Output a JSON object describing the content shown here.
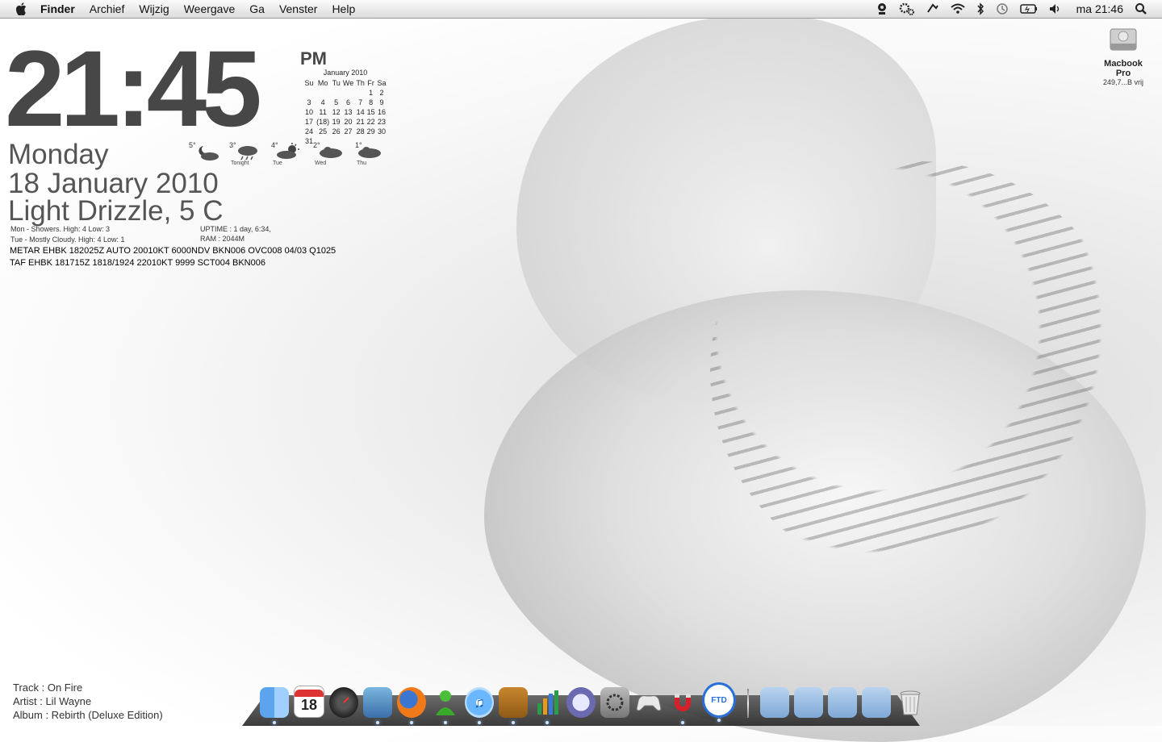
{
  "menubar": {
    "app_name": "Finder",
    "menus": [
      "Archief",
      "Wijzig",
      "Weergave",
      "Ga",
      "Venster",
      "Help"
    ],
    "clock": "ma 21:46"
  },
  "widget": {
    "time": "21:45",
    "ampm": "PM",
    "day": "Monday",
    "date": "18 January 2010",
    "condition": "Light Drizzle, 5 C",
    "forecast_line1": "Mon - Showers. High: 4 Low: 3",
    "forecast_line2": "Tue - Mostly Cloudy. High: 4 Low: 1",
    "uptime": "UPTIME : 1 day, 6:34,",
    "ram": "RAM : 2044M",
    "metar": "METAR EHBK 182025Z AUTO 20010KT 6000NDV BKN006 OVC008 04/03 Q1025",
    "taf": "TAF EHBK 181715Z 1818/1924 22010KT 9999 SCT004 BKN006"
  },
  "calendar": {
    "title": "January 2010",
    "days": [
      "Su",
      "Mo",
      "Tu",
      "We",
      "Th",
      "Fr",
      "Sa"
    ],
    "weeks": [
      [
        "",
        "",
        "",
        "",
        "",
        "1",
        "2"
      ],
      [
        "3",
        "4",
        "5",
        "6",
        "7",
        "8",
        "9"
      ],
      [
        "10",
        "11",
        "12",
        "13",
        "14",
        "15",
        "16"
      ],
      [
        "17",
        "(18)",
        "19",
        "20",
        "21",
        "22",
        "23"
      ],
      [
        "24",
        "25",
        "26",
        "27",
        "28",
        "29",
        "30"
      ],
      [
        "31",
        "",
        "",
        "",
        "",
        "",
        ""
      ]
    ]
  },
  "forecast": [
    {
      "temp": "5°",
      "label": "",
      "icon": "night-cloud-icon"
    },
    {
      "temp": "3°",
      "label": "Tonight",
      "icon": "rain-cloud-icon"
    },
    {
      "temp": "4°",
      "label": "Tue",
      "icon": "sun-cloud-icon"
    },
    {
      "temp": "2°",
      "label": "Wed",
      "icon": "cloud-icon"
    },
    {
      "temp": "1°",
      "label": "Thu",
      "icon": "cloud-icon"
    }
  ],
  "desktop": {
    "drive_name": "Macbook Pro",
    "drive_free": "249,7...B vrij"
  },
  "now_playing": {
    "track": "Track  : On Fire",
    "artist": "Artist : Lil Wayne",
    "album": "Album  : Rebirth (Deluxe Edition)"
  },
  "dock": {
    "calendar_day": "18",
    "ftd_label": "FTD",
    "apps": [
      "finder-icon",
      "ical-icon",
      "dashboard-icon",
      "mail-icon",
      "firefox-icon",
      "messenger-icon",
      "itunes-icon",
      "keynote-icon",
      "numbers-icon",
      "script-editor-icon",
      "system-preferences-icon",
      "game-controller-icon",
      "magnet-icon",
      "ftd-icon"
    ],
    "folders": [
      "downloads-folder-icon",
      "documents-folder-icon",
      "pictures-folder-icon",
      "applications-folder-icon"
    ],
    "trash": "trash-icon"
  },
  "colors": {
    "clock_text": "#474747",
    "menubar_bg": "#e8e8e8"
  }
}
